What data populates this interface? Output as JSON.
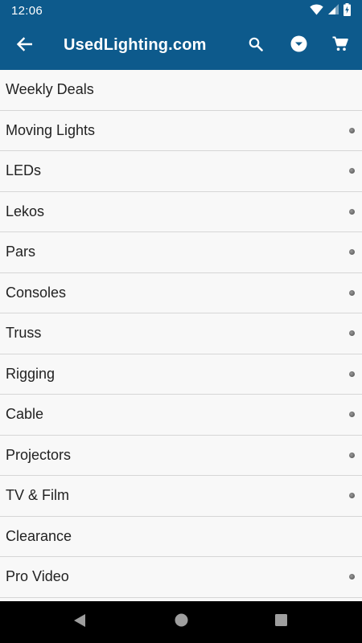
{
  "status_bar": {
    "time": "12:06",
    "icons": [
      "wifi-icon",
      "signal-icon",
      "battery-charging-icon"
    ]
  },
  "app_bar": {
    "title": "UsedLighting.com",
    "back_icon": "arrow-left-icon",
    "actions": [
      "search-icon",
      "dropdown-circle-icon",
      "cart-icon"
    ],
    "background_color": "#0d5a8c"
  },
  "categories": [
    {
      "label": "Weekly Deals",
      "has_submenu": false
    },
    {
      "label": "Moving Lights",
      "has_submenu": true
    },
    {
      "label": "LEDs",
      "has_submenu": true
    },
    {
      "label": "Lekos",
      "has_submenu": true
    },
    {
      "label": "Pars",
      "has_submenu": true
    },
    {
      "label": "Consoles",
      "has_submenu": true
    },
    {
      "label": "Truss",
      "has_submenu": true
    },
    {
      "label": "Rigging",
      "has_submenu": true
    },
    {
      "label": "Cable",
      "has_submenu": true
    },
    {
      "label": "Projectors",
      "has_submenu": true
    },
    {
      "label": "TV & Film",
      "has_submenu": true
    },
    {
      "label": "Clearance",
      "has_submenu": false
    },
    {
      "label": "Pro Video",
      "has_submenu": true
    }
  ],
  "nav_bar": {
    "buttons": [
      "back-triangle-icon",
      "home-circle-icon",
      "recents-square-icon"
    ]
  }
}
